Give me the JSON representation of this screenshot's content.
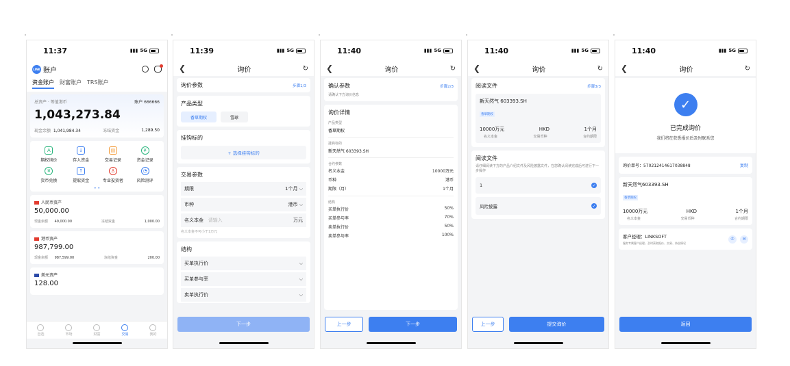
{
  "status_times": [
    "11:37",
    "11:39",
    "11:40",
    "11:40",
    "11:40"
  ],
  "network": "5G",
  "screen1": {
    "logo": "LINK",
    "title": "账户",
    "tabs": [
      "资金账户",
      "财富账户",
      "TRS账户"
    ],
    "total_label": "总资产 · 等值港币",
    "account_label": "账户 666666",
    "total_value": "1,043,273.84",
    "cash_label": "现金余额",
    "cash_value": "1,041,984.34",
    "frozen_label": "冻结资金",
    "frozen_value": "1,289.50",
    "actions": [
      "期权询价",
      "存入资金",
      "交易记录",
      "资金记录",
      "货币兑换",
      "提取资金",
      "专业投资者",
      "风险测评"
    ],
    "assets": [
      {
        "name": "人民币资产",
        "value": "50,000.00",
        "cash_label": "现金余额",
        "cash": "49,000.00",
        "frozen_label": "冻结资金",
        "frozen": "1,000.00",
        "color": "#e23b2e"
      },
      {
        "name": "港币资产",
        "value": "987,799.00",
        "cash_label": "现金余额",
        "cash": "987,599.00",
        "frozen_label": "冻结资金",
        "frozen": "200.00",
        "color": "#e23b2e"
      },
      {
        "name": "美元资产",
        "value": "128.00",
        "color": "#2c4aa8"
      }
    ],
    "tabbar": [
      "自选",
      "市场",
      "财富",
      "交易",
      "我的"
    ]
  },
  "screen2": {
    "title": "询价",
    "section": "询价参数",
    "step": "步骤1/3",
    "product_type_label": "产品类型",
    "product_options": [
      "香草期权",
      "雪球"
    ],
    "underlying_label": "挂钩标的",
    "underlying_action": "+ 选择挂钩标的",
    "trade_params_label": "交易参数",
    "term_label": "期限",
    "term_value": "1个月",
    "currency_label": "币种",
    "currency_value": "港币",
    "notional_label": "名义本金",
    "notional_placeholder": "请输入",
    "notional_unit": "万元",
    "notional_hint": "名义本金不可小于1万元",
    "structure_label": "结构",
    "structure_items": [
      "买单执行价",
      "买单参与率",
      "卖单执行价"
    ],
    "next": "下一步"
  },
  "screen3": {
    "title": "询价",
    "confirm_label": "确认参数",
    "confirm_hint": "请确认下方询价信息",
    "step": "步骤2/3",
    "detail_label": "询价详情",
    "product_type_label": "产品类型",
    "product_type": "香草期权",
    "underlying_label": "挂钩标的",
    "underlying": "新天然气 603393.SH",
    "contract_label": "合约参数",
    "contract_rows": [
      [
        "名义本金",
        "10000万元"
      ],
      [
        "币种",
        "港币"
      ],
      [
        "期限（月）",
        "1个月"
      ]
    ],
    "structure_label": "结构",
    "structure_rows": [
      [
        "买单执行价",
        "50%"
      ],
      [
        "买单参与率",
        "70%"
      ],
      [
        "卖单执行价",
        "50%"
      ],
      [
        "卖单参与率",
        "100%"
      ]
    ],
    "prev": "上一步",
    "next": "下一步"
  },
  "screen4": {
    "title": "询价",
    "read_label": "阅读文件",
    "step": "步骤3/3",
    "product": "新天然气 603393.SH",
    "tag": "香草期权",
    "amount": "10000万元",
    "amount_label": "名义本金",
    "currency": "HKD",
    "currency_label": "交易币种",
    "term": "1个月",
    "term_label": "合约期限",
    "read2_label": "阅读文件",
    "read_hint": "请仔细阅读下方的产品介绍文件及风险披露文件，在您确认阅读完成后可进行下一步操作",
    "docs": [
      "1",
      "风险披露"
    ],
    "prev": "上一步",
    "submit": "提交询价"
  },
  "screen5": {
    "title": "询价",
    "done_title": "已完成询价",
    "done_hint": "我们将在获悉报价后及时联系您",
    "order_label": "询价单号：",
    "order_no": "570212414617038848",
    "copy": "复制",
    "product": "新天然气603393.SH",
    "tag": "香草期权",
    "amount": "10000万元",
    "amount_label": "名义本金",
    "currency": "HKD",
    "currency_label": "交易币种",
    "term": "1个月",
    "term_label": "合约期限",
    "manager_label": "客户经理：LINKSOFT",
    "manager_hint": "服务专属客户经理，及时获取报价、交易、持仓情况",
    "back": "返回"
  },
  "colors": {
    "accent": "#3d7ff0",
    "success": "#2ab57d",
    "background": "#f3f4f6"
  }
}
